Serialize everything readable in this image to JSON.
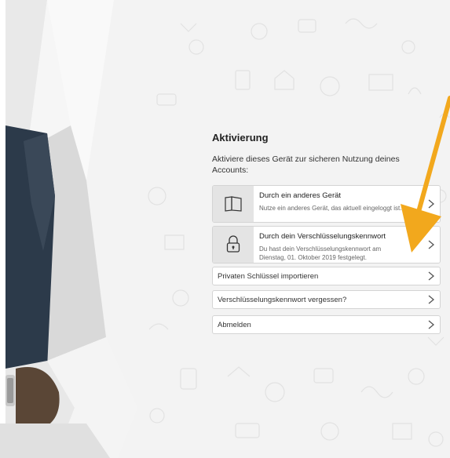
{
  "activation": {
    "title": "Aktivierung",
    "subtitle": "Aktiviere dieses Gerät zur sicheren Nutzung deines Accounts:",
    "options": [
      {
        "title": "Durch ein anderes Gerät",
        "description": "Nutze ein anderes Gerät, das aktuell eingeloggt ist.",
        "icon": "book-icon"
      },
      {
        "title": "Durch dein Verschlüsselungskennwort",
        "description": "Du hast dein Verschlüsselungskennwort am Dienstag, 01. Oktober 2019 festgelegt.",
        "icon": "lock-icon"
      }
    ],
    "links": [
      {
        "label": "Privaten Schlüssel importieren"
      },
      {
        "label": "Verschlüsselungskennwort vergessen?"
      },
      {
        "label": "Abmelden"
      }
    ]
  },
  "colors": {
    "background": "#f3f3f3",
    "card": "#ffffff",
    "icon_box": "#e4e4e4",
    "arrow": "#f2a81d",
    "border": "#d4d4d4"
  }
}
